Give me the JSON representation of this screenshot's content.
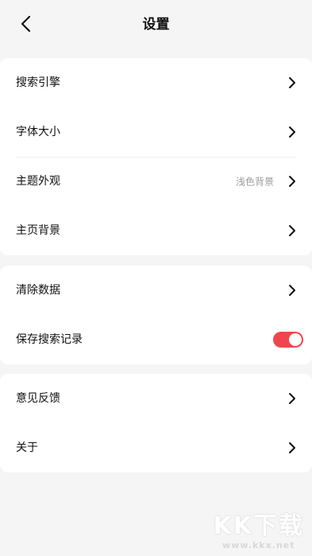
{
  "header": {
    "title": "设置",
    "back_icon": "chevron-left-icon"
  },
  "group1": {
    "items": [
      {
        "label": "搜索引擎"
      },
      {
        "label": "字体大小"
      },
      {
        "label": "主题外观",
        "value": "浅色背景"
      },
      {
        "label": "主页背景"
      }
    ]
  },
  "group2": {
    "items": [
      {
        "label": "清除数据"
      },
      {
        "label": "保存搜索记录",
        "toggle_on": true
      }
    ]
  },
  "group3": {
    "items": [
      {
        "label": "意见反馈"
      },
      {
        "label": "关于"
      }
    ]
  },
  "colors": {
    "accent": "#f1454d",
    "background": "#f5f5f5",
    "card": "#ffffff",
    "secondary_text": "#9a9a9a"
  },
  "watermark": {
    "logo": "KK下载",
    "url": "www.kkx.net"
  }
}
